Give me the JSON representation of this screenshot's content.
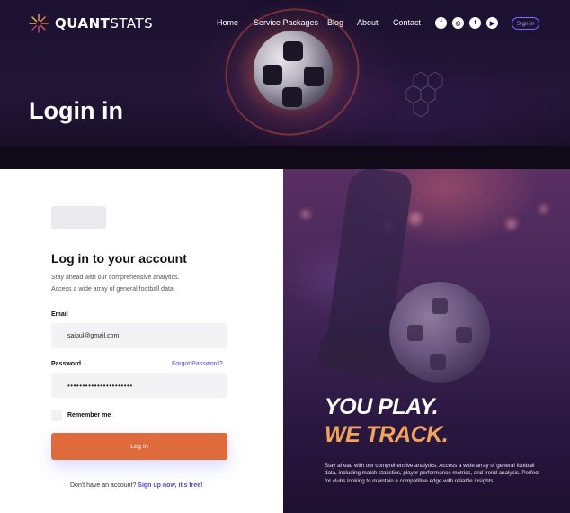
{
  "header": {
    "logo": {
      "bold": "QUANT",
      "light": "STATS"
    },
    "nav": [
      {
        "label": "Home"
      },
      {
        "label": "Service Packages"
      },
      {
        "label": "Blog"
      },
      {
        "label": "About"
      },
      {
        "label": "Contact"
      }
    ],
    "socials": [
      {
        "icon": "facebook-icon",
        "glyph": "f"
      },
      {
        "icon": "instagram-icon",
        "glyph": "◎"
      },
      {
        "icon": "twitter-icon",
        "glyph": "t"
      },
      {
        "icon": "youtube-icon",
        "glyph": "▶"
      }
    ],
    "signin_label": "Sign in"
  },
  "hero": {
    "title": "Login in"
  },
  "form": {
    "title": "Log in to your account",
    "subtitle_line1": "Stay ahead with our comprehensive analytics.",
    "subtitle_line2": "Access a wide array of general football data,",
    "email_label": "Email",
    "email_value": "saipul@gmail.com",
    "password_label": "Password",
    "password_value": "••••••••••••••••••••••",
    "forgot_label": "Forgot Password?",
    "remember_label": "Remember me",
    "login_label": "Log In",
    "signup_prefix": "Don't have an account?",
    "signup_link": "Sign up now, it's free!"
  },
  "promo": {
    "slogan_line1": "YOU PLAY.",
    "slogan_line2": "WE TRACK.",
    "text": "Stay ahead with our comprehensive analytics. Access a wide array of general football data, including match statistics, player performance metrics, and trend analysis. Perfect for clubs looking to maintain a competitive edge with reliable insights."
  },
  "colors": {
    "accent": "#df6a3c",
    "link": "#5148c9",
    "slogan_highlight": "#f2a45a",
    "hero_bg": "#1c1130"
  }
}
